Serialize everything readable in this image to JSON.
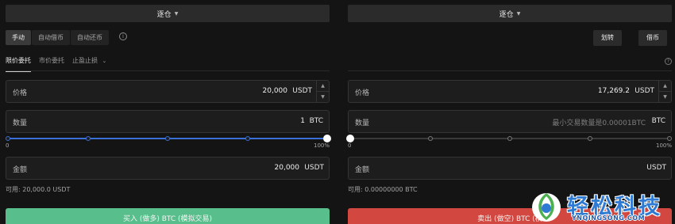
{
  "left": {
    "margin_mode": "逐仓",
    "mode_tabs": [
      "手动",
      "自动借币",
      "自动还币"
    ],
    "order_tabs": [
      "限价委托",
      "市价委托",
      "止盈止损"
    ],
    "price": {
      "label": "价格",
      "value": "20,000",
      "unit": "USDT"
    },
    "quantity": {
      "label": "数量",
      "value": "1",
      "unit": "BTC"
    },
    "slider": {
      "level_percent": 100,
      "min_label": "0",
      "max_label": "100%"
    },
    "amount": {
      "label": "金额",
      "value": "20,000",
      "unit": "USDT"
    },
    "available": "可用: 20,000.0 USDT",
    "action": "买入 (做多) BTC (模拟交易)"
  },
  "right": {
    "margin_mode": "逐仓",
    "transfer_label": "划转",
    "borrow_label": "借币",
    "price": {
      "label": "价格",
      "value": "17,269.2",
      "unit": "USDT"
    },
    "quantity": {
      "label": "数量",
      "placeholder": "最小交易数量是0.00001BTC",
      "unit": "BTC"
    },
    "slider": {
      "level_percent": 0,
      "min_label": "0",
      "max_label": "100%"
    },
    "amount": {
      "label": "金额",
      "value": "",
      "unit": "USDT"
    },
    "available": "可用: 0.00000000 BTC",
    "action": "卖出 (做空) BTC (模"
  },
  "watermark": {
    "cn": "轻松科技",
    "en": "YNQINGSONG.COM"
  },
  "colors": {
    "buy": "#58bf8c",
    "sell": "#d2473f",
    "slider_fill": "#3b6fd8",
    "watermark": "#2f7bd3"
  }
}
